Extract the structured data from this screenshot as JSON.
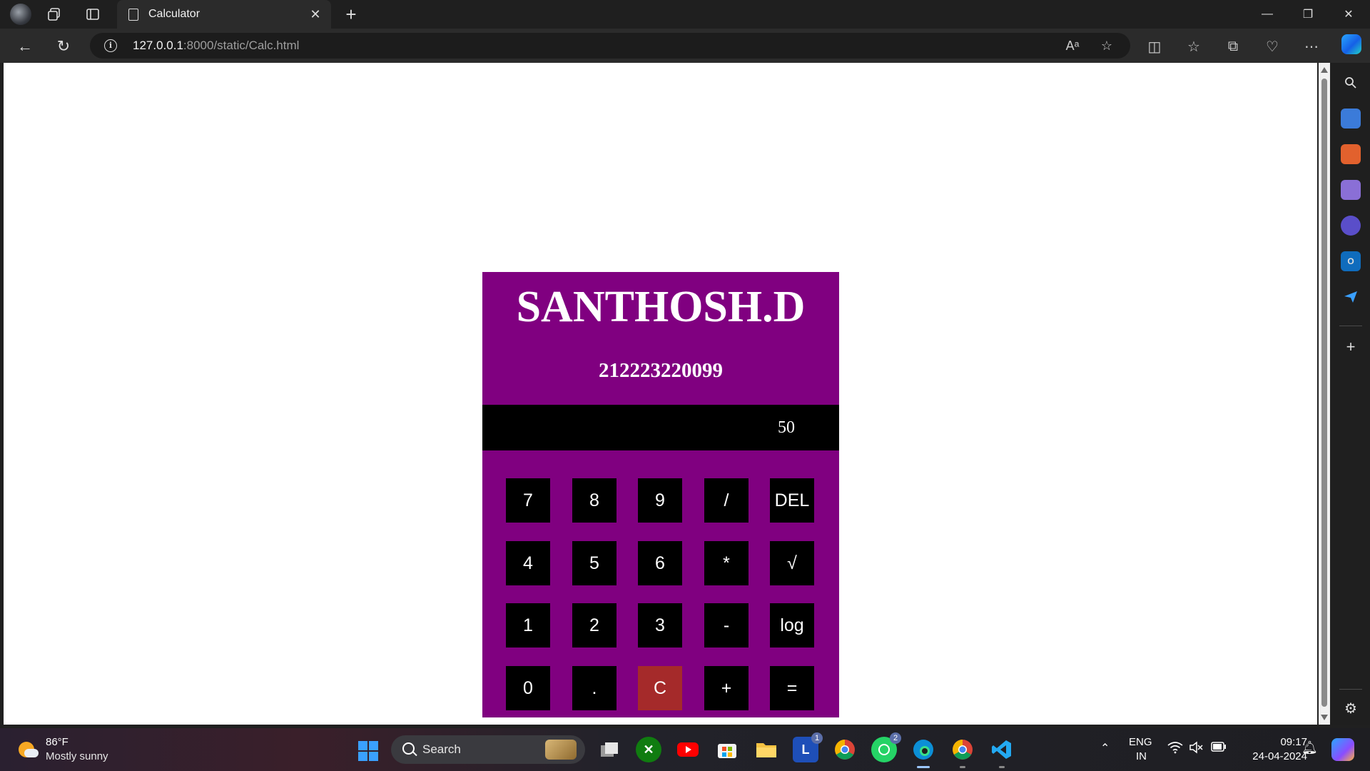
{
  "browser": {
    "tab_title": "Calculator",
    "url_host": "127.0.0.1",
    "url_rest": ":8000/static/Calc.html"
  },
  "calculator": {
    "name": "SANTHOSH.D",
    "register_number": "212223220099",
    "display_value": "50",
    "keys": [
      {
        "label": "7"
      },
      {
        "label": "8"
      },
      {
        "label": "9"
      },
      {
        "label": "/"
      },
      {
        "label": "DEL"
      },
      {
        "label": "4"
      },
      {
        "label": "5"
      },
      {
        "label": "6"
      },
      {
        "label": "*"
      },
      {
        "label": "√"
      },
      {
        "label": "1"
      },
      {
        "label": "2"
      },
      {
        "label": "3"
      },
      {
        "label": "-"
      },
      {
        "label": "log"
      },
      {
        "label": "0"
      },
      {
        "label": "."
      },
      {
        "label": "C"
      },
      {
        "label": "+"
      },
      {
        "label": "="
      }
    ],
    "colors": {
      "panel": "#800080",
      "display": "#000000",
      "key": "#000000",
      "clear_key": "#a52a2a"
    }
  },
  "taskbar": {
    "weather_temp": "86°F",
    "weather_desc": "Mostly sunny",
    "search_label": "Search",
    "badge_l": "1",
    "badge_whatsapp": "2",
    "lang_top": "ENG",
    "lang_bottom": "IN",
    "time": "09:17",
    "date": "24-04-2024"
  }
}
